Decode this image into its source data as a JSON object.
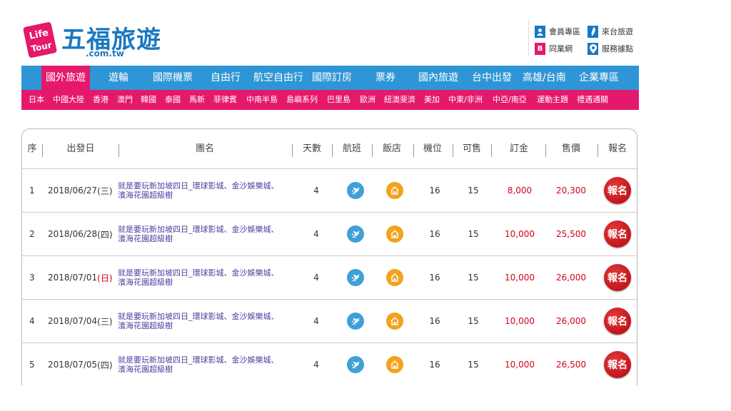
{
  "logo": {
    "badge_top": "Life",
    "badge_bottom": "Tour",
    "name": "五福旅遊",
    "domain": ".com.tw"
  },
  "top_links": [
    {
      "label": "會員專區",
      "icon": "member-icon"
    },
    {
      "label": "來台旅遊",
      "icon": "taiwan-icon"
    },
    {
      "label": "同業網",
      "icon": "b-icon"
    },
    {
      "label": "服務據點",
      "icon": "location-pin-icon"
    }
  ],
  "nav_main": [
    "國外旅遊",
    "遊輪",
    "國際機票",
    "自由行",
    "航空自由行",
    "國際訂房",
    "票券",
    "國內旅遊",
    "台中出發",
    "高雄/台南",
    "企業專區"
  ],
  "nav_sub": [
    "日本",
    "中國大陸",
    "香港",
    "澳門",
    "韓國",
    "泰國",
    "馬新",
    "菲律賓",
    "中南半島",
    "島嶼系列",
    "巴里島",
    "歐洲",
    "紐澳斐濟",
    "美加",
    "中東/非洲",
    "中亞/南亞",
    "運動主題",
    "禮遇通關"
  ],
  "table": {
    "headers": [
      "序",
      "出發日",
      "團名",
      "天數",
      "航班",
      "飯店",
      "機位",
      "可售",
      "訂金",
      "售價",
      "報名"
    ],
    "rows": [
      {
        "no": "1",
        "date": "2018/06/27",
        "weekday": "(三)",
        "sunday": false,
        "name": "就是要玩新加坡四日_環球影城、金沙娛樂城、濱海花園超級樹",
        "days": "4",
        "seats": "16",
        "available": "15",
        "deposit": "8,000",
        "price": "20,300",
        "signup": "報名"
      },
      {
        "no": "2",
        "date": "2018/06/28",
        "weekday": "(四)",
        "sunday": false,
        "name": "就是要玩新加坡四日_環球影城、金沙娛樂城、濱海花園超級樹",
        "days": "4",
        "seats": "16",
        "available": "15",
        "deposit": "10,000",
        "price": "25,500",
        "signup": "報名"
      },
      {
        "no": "3",
        "date": "2018/07/01",
        "weekday": "(日)",
        "sunday": true,
        "name": "就是要玩新加坡四日_環球影城、金沙娛樂城、濱海花園超級樹",
        "days": "4",
        "seats": "16",
        "available": "15",
        "deposit": "10,000",
        "price": "26,000",
        "signup": "報名"
      },
      {
        "no": "4",
        "date": "2018/07/04",
        "weekday": "(三)",
        "sunday": false,
        "name": "就是要玩新加坡四日_環球影城、金沙娛樂城、濱海花園超級樹",
        "days": "4",
        "seats": "16",
        "available": "15",
        "deposit": "10,000",
        "price": "26,000",
        "signup": "報名"
      },
      {
        "no": "5",
        "date": "2018/07/05",
        "weekday": "(四)",
        "sunday": false,
        "name": "就是要玩新加坡四日_環球影城、金沙娛樂城、濱海花園超級樹",
        "days": "4",
        "seats": "16",
        "available": "15",
        "deposit": "10,000",
        "price": "26,500",
        "signup": "報名"
      }
    ]
  },
  "colors": {
    "brand_blue": "#1a78c2",
    "nav_blue": "#2e96d6",
    "brand_pink": "#e5196c",
    "price_red": "#d0021b"
  }
}
